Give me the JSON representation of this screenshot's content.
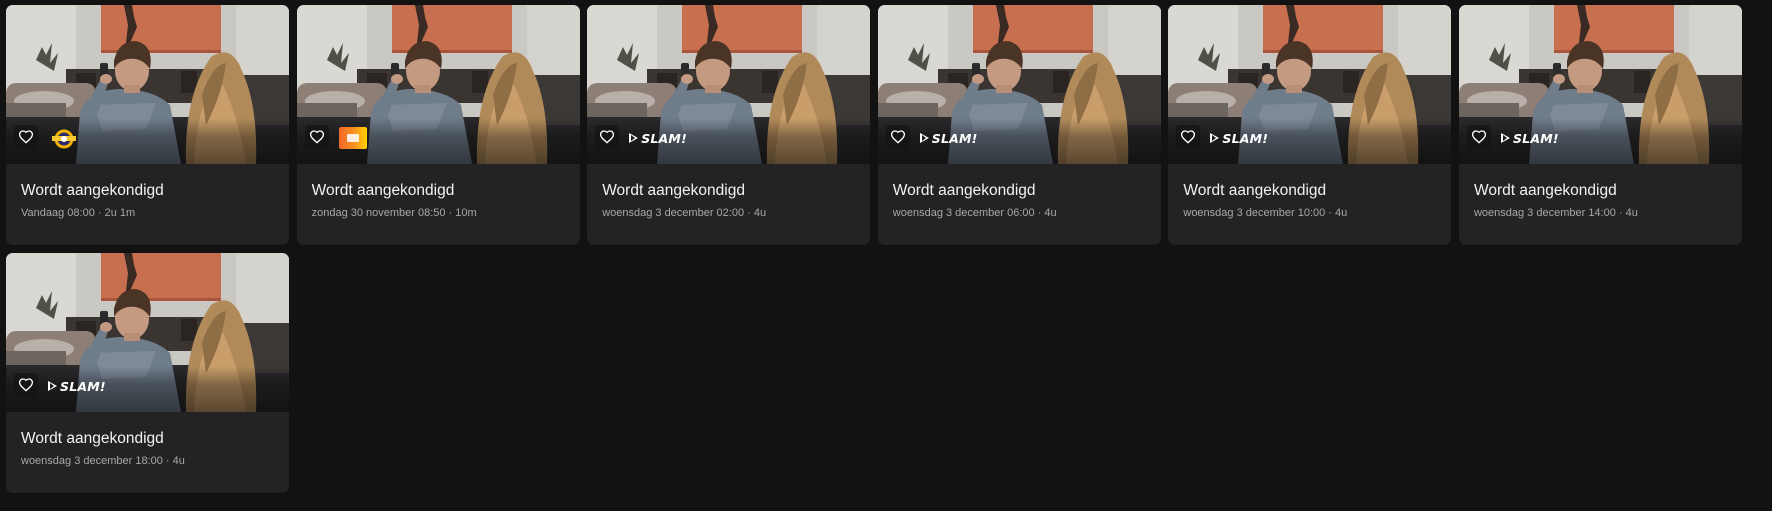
{
  "programs": [
    {
      "title": "Wordt aangekondigd",
      "meta": "Vandaag 08:00 · 2u 1m",
      "channel": "tv-channel-logo"
    },
    {
      "title": "Wordt aangekondigd",
      "meta": "zondag 30 november 08:50 · 10m",
      "channel": "orange-channel-logo"
    },
    {
      "title": "Wordt aangekondigd",
      "meta": "woensdag 3 december 02:00 · 4u",
      "channel": "slam-logo",
      "channel_text": "SLAM!"
    },
    {
      "title": "Wordt aangekondigd",
      "meta": "woensdag 3 december 06:00 · 4u",
      "channel": "slam-logo",
      "channel_text": "SLAM!"
    },
    {
      "title": "Wordt aangekondigd",
      "meta": "woensdag 3 december 10:00 · 4u",
      "channel": "slam-logo",
      "channel_text": "SLAM!"
    },
    {
      "title": "Wordt aangekondigd",
      "meta": "woensdag 3 december 14:00 · 4u",
      "channel": "slam-logo",
      "channel_text": "SLAM!"
    },
    {
      "title": "Wordt aangekondigd",
      "meta": "woensdag 3 december 18:00 · 4u",
      "channel": "slam-logo",
      "channel_text": "SLAM!"
    }
  ],
  "icons": {
    "favorite": "heart-outline-icon"
  },
  "colors": {
    "background": "#121212",
    "card": "#232323",
    "title": "#f2f2f2",
    "meta": "#a8a8a8"
  }
}
